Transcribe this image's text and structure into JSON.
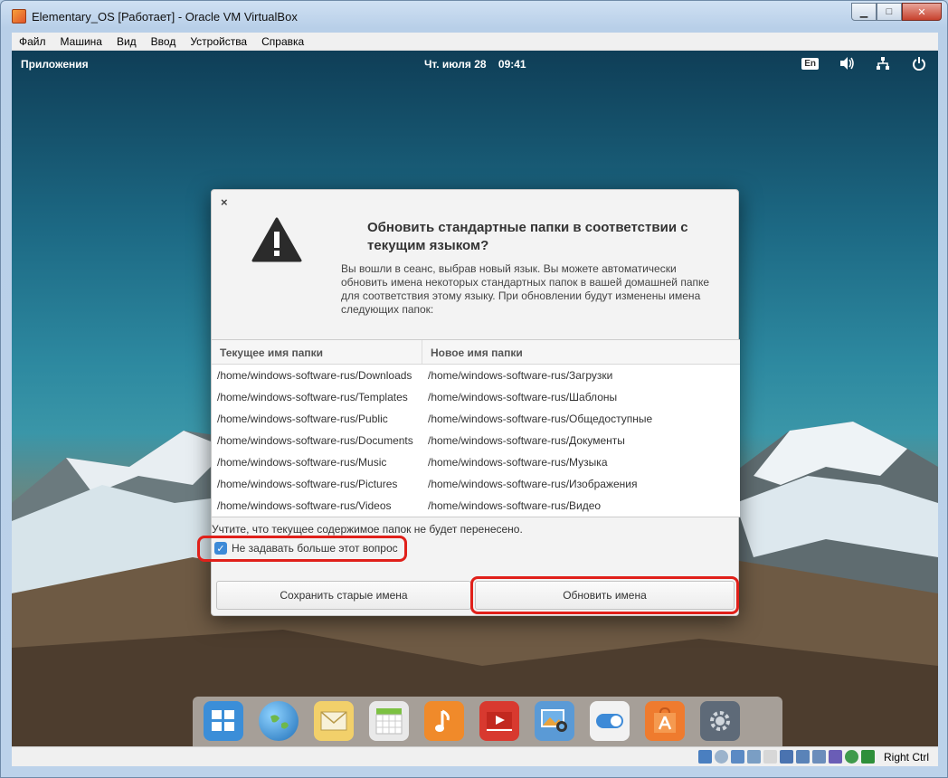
{
  "host": {
    "title": "Elementary_OS [Работает] - Oracle VM VirtualBox",
    "menu": [
      "Файл",
      "Машина",
      "Вид",
      "Ввод",
      "Устройства",
      "Справка"
    ],
    "host_key": "Right Ctrl"
  },
  "panel": {
    "apps": "Приложения",
    "date": "Чт. июля 28",
    "time": "09:41",
    "lang": "En"
  },
  "dialog": {
    "close": "×",
    "title": "Обновить стандартные папки в соответствии с текущим языком?",
    "text": "Вы вошли в сеанс, выбрав новый язык. Вы можете автоматически обновить имена некоторых стандартных папок в вашей домашней папке для соответствия этому языку. При обновлении будут изменены имена следующих папок:",
    "col_current": "Текущее имя папки",
    "col_new": "Новое имя папки",
    "rows": [
      {
        "current": "/home/windows-software-rus/Downloads",
        "new": "/home/windows-software-rus/Загрузки"
      },
      {
        "current": "/home/windows-software-rus/Templates",
        "new": "/home/windows-software-rus/Шаблоны"
      },
      {
        "current": "/home/windows-software-rus/Public",
        "new": "/home/windows-software-rus/Общедоступные"
      },
      {
        "current": "/home/windows-software-rus/Documents",
        "new": "/home/windows-software-rus/Документы"
      },
      {
        "current": "/home/windows-software-rus/Music",
        "new": "/home/windows-software-rus/Музыка"
      },
      {
        "current": "/home/windows-software-rus/Pictures",
        "new": "/home/windows-software-rus/Изображения"
      },
      {
        "current": "/home/windows-software-rus/Videos",
        "new": "/home/windows-software-rus/Видео"
      }
    ],
    "note": "Учтите, что текущее содержимое папок не будет перенесено.",
    "checkbox_label": "Не задавать больше этот вопрос",
    "checkbox_checked": true,
    "btn_keep": "Сохранить старые имена",
    "btn_update": "Обновить имена"
  },
  "dock": [
    {
      "icon": "multitasking-view-icon",
      "color": "#3b8ed8"
    },
    {
      "icon": "web-browser-icon",
      "color": "#2f83c7"
    },
    {
      "icon": "mail-icon",
      "color": "#f2d06a"
    },
    {
      "icon": "calendar-icon",
      "color": "#e9e9e9"
    },
    {
      "icon": "music-icon",
      "color": "#f08a2a"
    },
    {
      "icon": "videos-icon",
      "color": "#d8392f"
    },
    {
      "icon": "photos-icon",
      "color": "#5a9ad6"
    },
    {
      "icon": "settings-switch-icon",
      "color": "#f2f2f2"
    },
    {
      "icon": "appcenter-icon",
      "color": "#ef7b2e"
    },
    {
      "icon": "system-settings-icon",
      "color": "#5e6a78"
    }
  ],
  "colors": {
    "highlight": "#e0201a",
    "checkbox": "#3d8ad7"
  }
}
